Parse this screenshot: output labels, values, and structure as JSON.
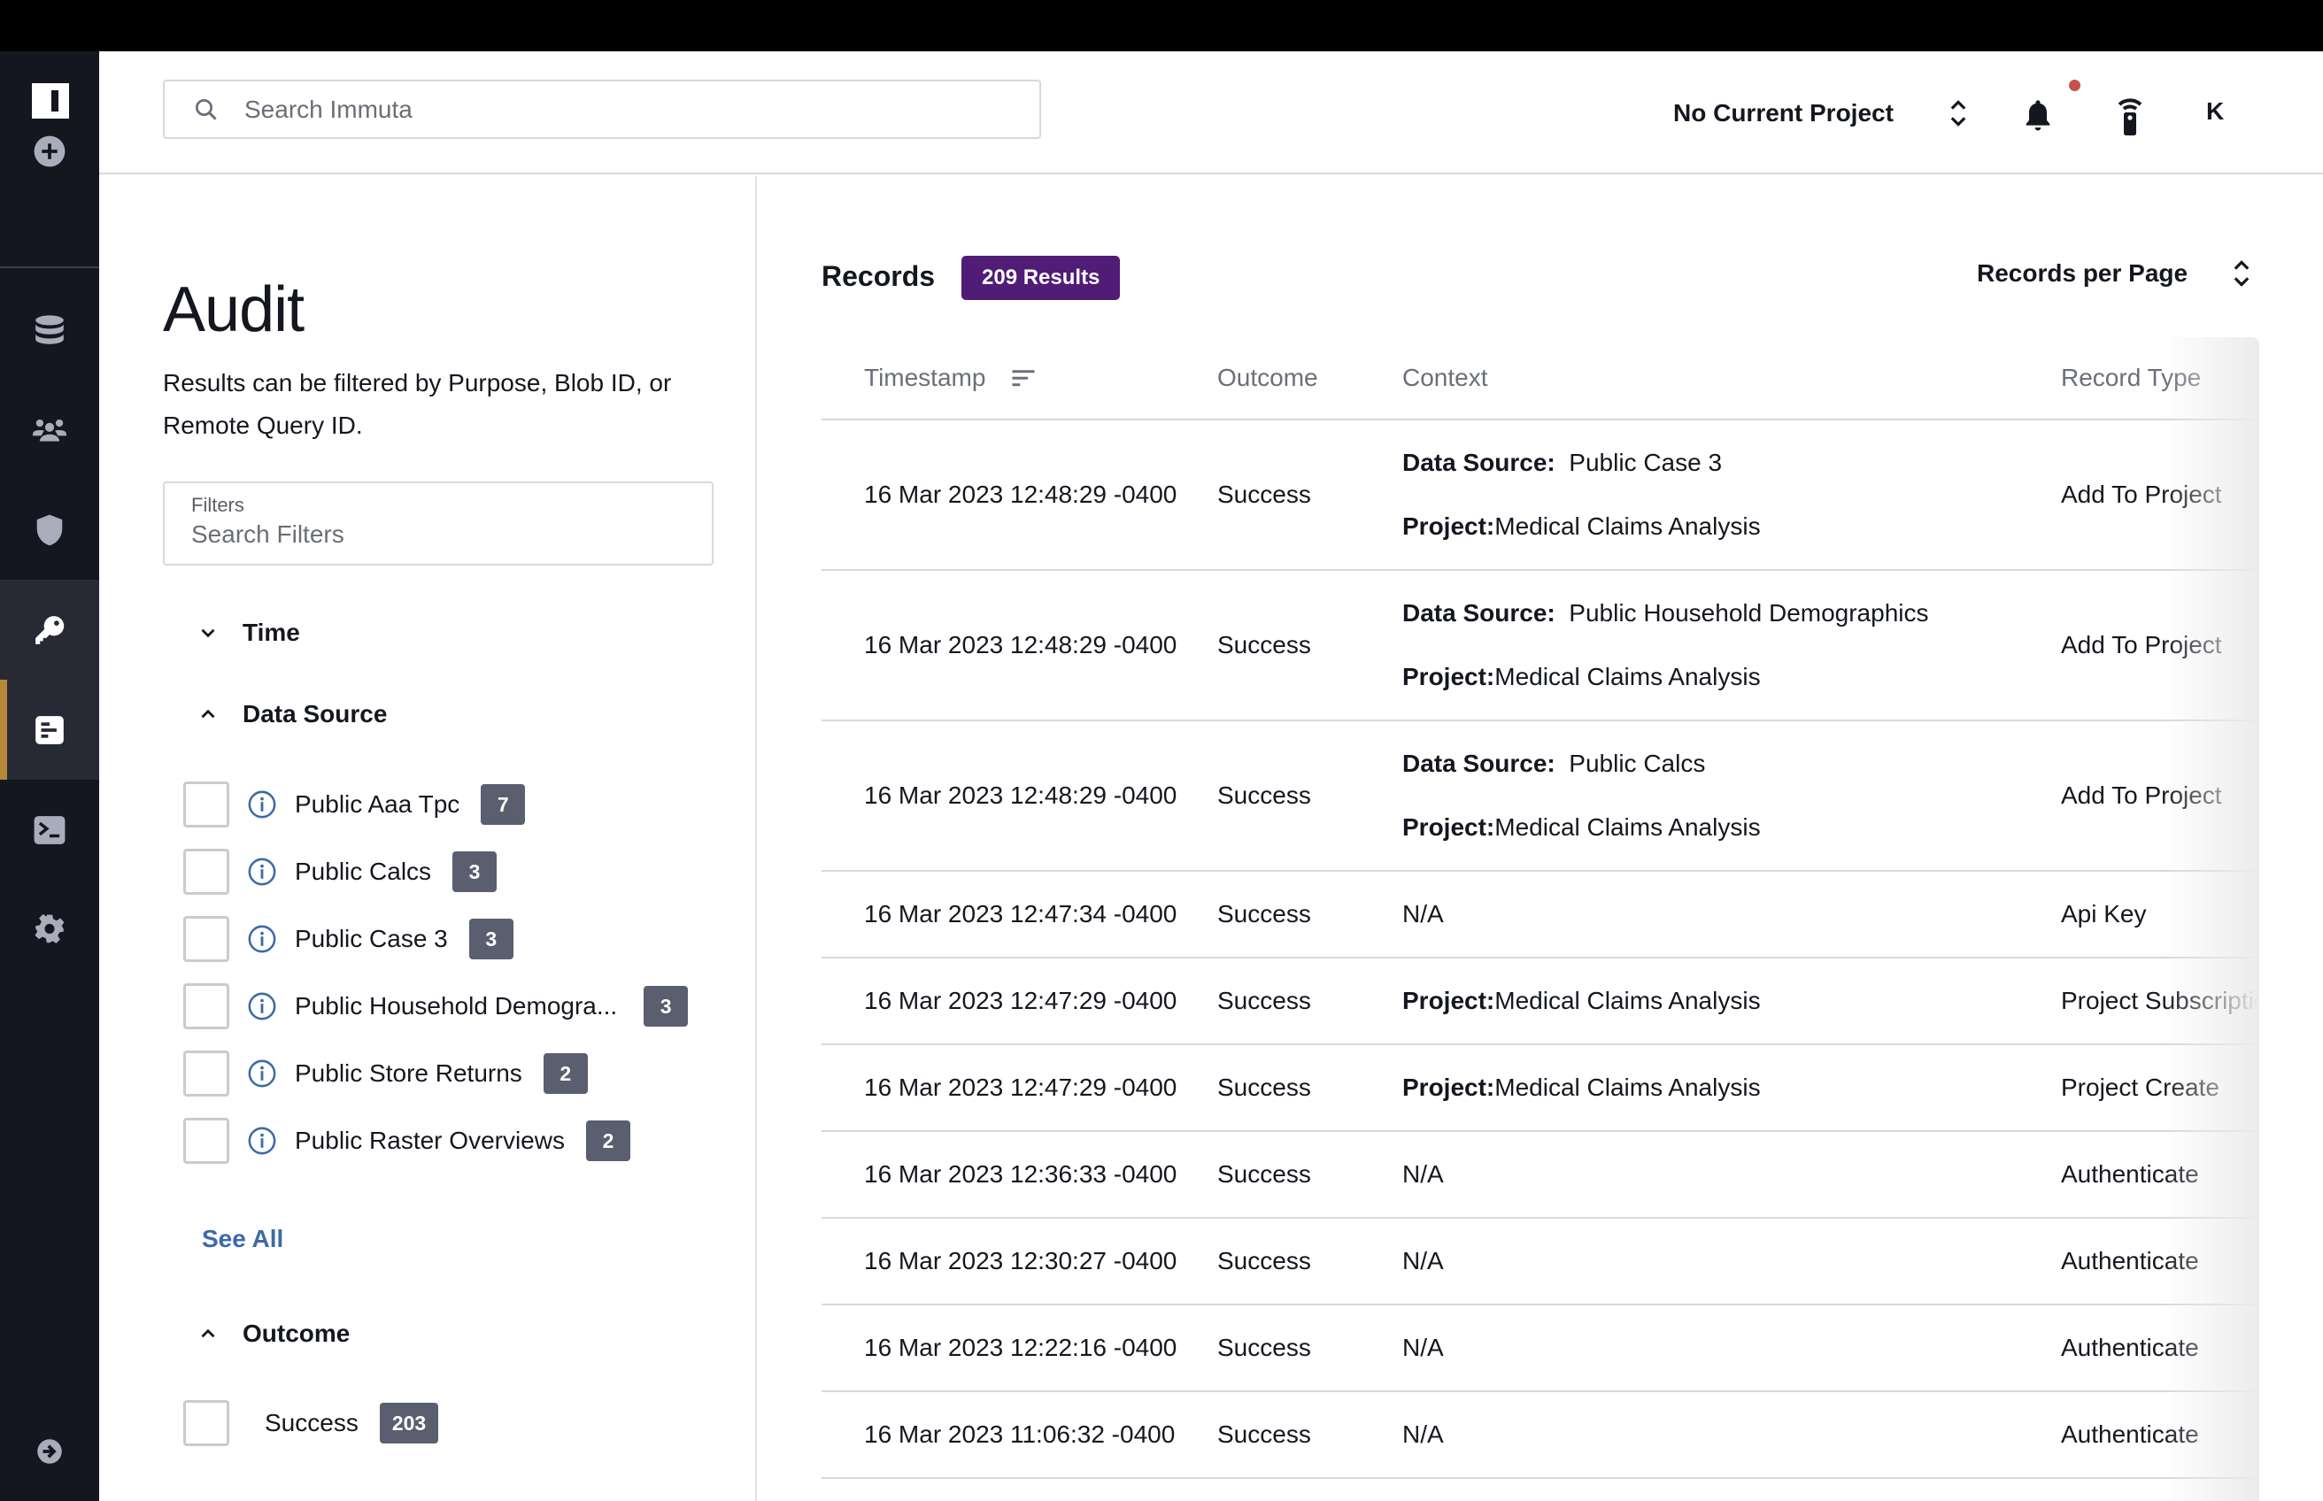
{
  "app": {
    "name": "Immuta"
  },
  "sidebar": {
    "items": [
      {
        "name": "add",
        "icon": "plus-circle-icon"
      },
      {
        "name": "data-sources",
        "icon": "database-icon"
      },
      {
        "name": "people",
        "icon": "people-icon"
      },
      {
        "name": "governance",
        "icon": "shield-icon"
      },
      {
        "name": "api-keys",
        "icon": "key-icon"
      },
      {
        "name": "audit",
        "icon": "audit-icon",
        "active": true
      },
      {
        "name": "query-editor",
        "icon": "terminal-icon"
      },
      {
        "name": "settings",
        "icon": "gear-icon"
      },
      {
        "name": "expand",
        "icon": "arrow-right-circle-icon"
      }
    ]
  },
  "header": {
    "search_placeholder": "Search Immuta",
    "project_label": "No Current Project",
    "avatar_initial": "K",
    "notification_dot_color": "#c5524a"
  },
  "left": {
    "title": "Audit",
    "description": "Results can be filtered by Purpose, Blob ID, or Remote Query ID.",
    "filter_label": "Filters",
    "filter_placeholder": "Search Filters",
    "sections": {
      "time": {
        "label": "Time",
        "expanded": false
      },
      "data_source": {
        "label": "Data Source",
        "expanded": true,
        "items": [
          {
            "label": "Public Aaa Tpc",
            "count": "7"
          },
          {
            "label": "Public Calcs",
            "count": "3"
          },
          {
            "label": "Public Case 3",
            "count": "3"
          },
          {
            "label": "Public Household Demogra...",
            "count": "3"
          },
          {
            "label": "Public Store Returns",
            "count": "2"
          },
          {
            "label": "Public Raster Overviews",
            "count": "2"
          }
        ],
        "see_all": "See All"
      },
      "outcome": {
        "label": "Outcome",
        "expanded": true,
        "items": [
          {
            "label": "Success",
            "count": "203"
          }
        ]
      }
    }
  },
  "records": {
    "title": "Records",
    "results_badge": "209 Results",
    "badge_color": "#501c75",
    "per_page_label": "Records per Page",
    "columns": [
      "Timestamp",
      "Outcome",
      "Context",
      "Record Type"
    ],
    "rows": [
      {
        "timestamp": "16 Mar 2023 12:48:29 -0400",
        "outcome": "Success",
        "context": [
          {
            "key": "Data Source:",
            "value": "  Public Case 3"
          },
          {
            "key": "Project:",
            "value": "Medical Claims Analysis"
          }
        ],
        "record_type": "Add To Project"
      },
      {
        "timestamp": "16 Mar 2023 12:48:29 -0400",
        "outcome": "Success",
        "context": [
          {
            "key": "Data Source:",
            "value": "  Public Household Demographics"
          },
          {
            "key": "Project:",
            "value": "Medical Claims Analysis"
          }
        ],
        "record_type": "Add To Project"
      },
      {
        "timestamp": "16 Mar 2023 12:48:29 -0400",
        "outcome": "Success",
        "context": [
          {
            "key": "Data Source:",
            "value": "  Public Calcs"
          },
          {
            "key": "Project:",
            "value": "Medical Claims Analysis"
          }
        ],
        "record_type": "Add To Project"
      },
      {
        "timestamp": "16 Mar 2023 12:47:34 -0400",
        "outcome": "Success",
        "context": [
          {
            "key": "",
            "value": "N/A"
          }
        ],
        "record_type": "Api Key"
      },
      {
        "timestamp": "16 Mar 2023 12:47:29 -0400",
        "outcome": "Success",
        "context": [
          {
            "key": "Project:",
            "value": "Medical Claims Analysis"
          }
        ],
        "record_type": "Project Subscription"
      },
      {
        "timestamp": "16 Mar 2023 12:47:29 -0400",
        "outcome": "Success",
        "context": [
          {
            "key": "Project:",
            "value": "Medical Claims Analysis"
          }
        ],
        "record_type": "Project Create"
      },
      {
        "timestamp": "16 Mar 2023 12:36:33 -0400",
        "outcome": "Success",
        "context": [
          {
            "key": "",
            "value": "N/A"
          }
        ],
        "record_type": "Authenticate"
      },
      {
        "timestamp": "16 Mar 2023 12:30:27 -0400",
        "outcome": "Success",
        "context": [
          {
            "key": "",
            "value": "N/A"
          }
        ],
        "record_type": "Authenticate"
      },
      {
        "timestamp": "16 Mar 2023 12:22:16 -0400",
        "outcome": "Success",
        "context": [
          {
            "key": "",
            "value": "N/A"
          }
        ],
        "record_type": "Authenticate"
      },
      {
        "timestamp": "16 Mar 2023 11:06:32 -0400",
        "outcome": "Success",
        "context": [
          {
            "key": "",
            "value": "N/A"
          }
        ],
        "record_type": "Authenticate"
      }
    ]
  }
}
